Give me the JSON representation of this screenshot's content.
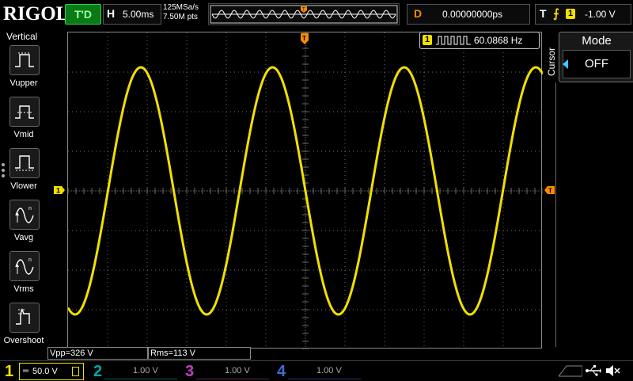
{
  "brand": "RIGOL",
  "trigger_status": "T'D",
  "horizontal": {
    "key": "H",
    "value": "5.00ms"
  },
  "sample": {
    "rate": "125MSa/s",
    "depth": "7.50M pts"
  },
  "delay": {
    "key": "D",
    "value": "0.00000000ps"
  },
  "trigger": {
    "key": "T",
    "edge": "rising",
    "channel": "1",
    "level": "-1.00 V"
  },
  "left_menu": {
    "title": "Vertical",
    "items": [
      {
        "label": "Vupper",
        "icon": "vupper-icon"
      },
      {
        "label": "Vmid",
        "icon": "vmid-icon"
      },
      {
        "label": "Vlower",
        "icon": "vlower-icon"
      },
      {
        "label": "Vavg",
        "icon": "vavg-icon"
      },
      {
        "label": "Vrms",
        "icon": "vrms-icon"
      },
      {
        "label": "Overshoot",
        "icon": "overshoot-icon"
      }
    ]
  },
  "freq_counter": {
    "channel": "1",
    "value": "60.0868 Hz"
  },
  "right_menu": {
    "side_label": "Cursor",
    "mode_title": "Mode",
    "mode_value": "OFF"
  },
  "measurements": [
    {
      "text": "Vpp=326 V"
    },
    {
      "text": "Rms=113 V"
    }
  ],
  "channels": [
    {
      "num": "1",
      "scale": "50.0 V",
      "color": "#f0e000",
      "active": true
    },
    {
      "num": "2",
      "scale": "1.00 V",
      "color": "#00c8c8",
      "active": false
    },
    {
      "num": "3",
      "scale": "1.00 V",
      "color": "#e040e0",
      "active": false
    },
    {
      "num": "4",
      "scale": "1.00 V",
      "color": "#3a7cff",
      "active": false
    }
  ],
  "markers": {
    "channel_marker": "1",
    "trigger_marker": "T"
  },
  "colors": {
    "ch1": "#f0e000",
    "trigger": "#ff8a00",
    "trig_status_bg": "#0a7a16"
  }
}
